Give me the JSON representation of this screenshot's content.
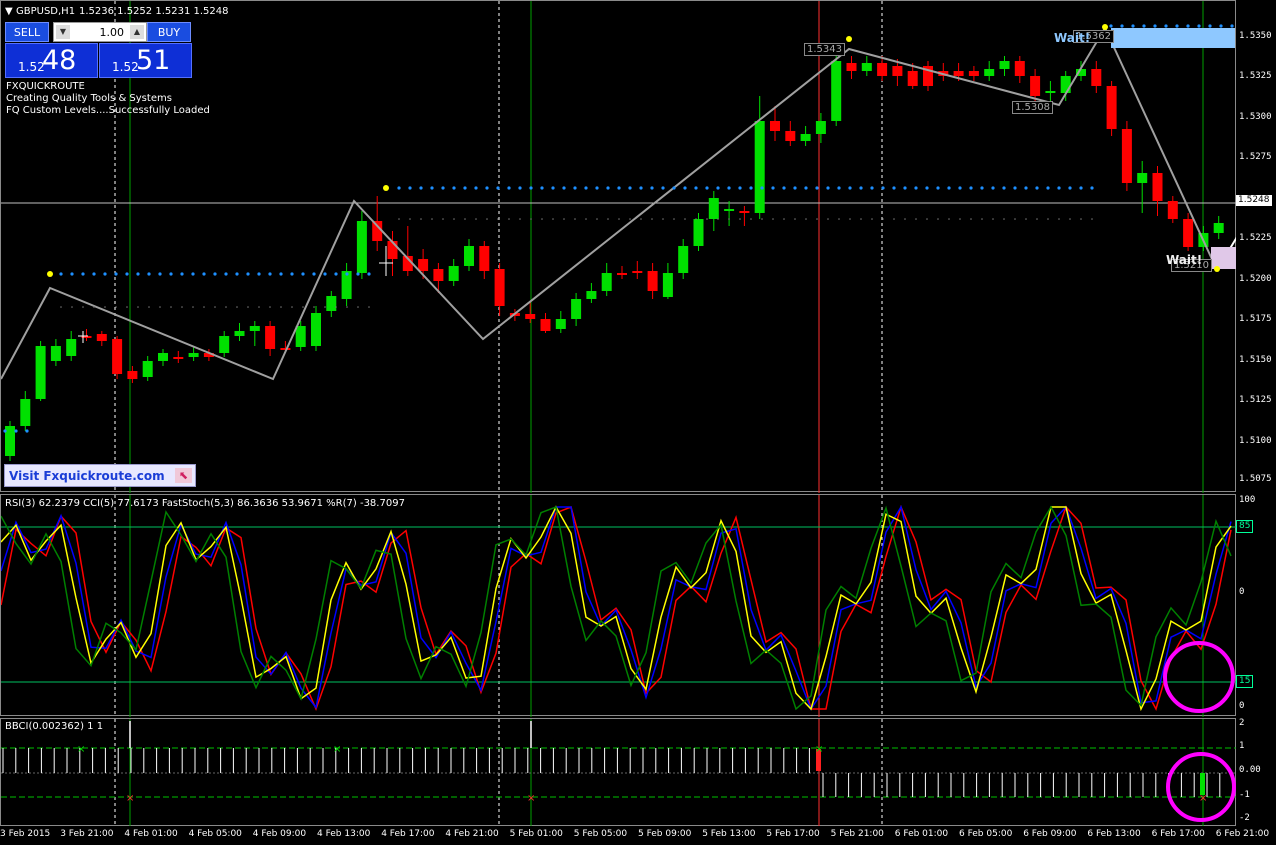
{
  "chart": {
    "symbol_timeframe": "GBPUSD,H1",
    "ohlc": "1.5236 1.5252 1.5231 1.5248",
    "current_price": "1.5248"
  },
  "trade_panel": {
    "sell_label": "SELL",
    "buy_label": "BUY",
    "lot_size": "1.00",
    "sell_price_small": "1.52",
    "sell_price_big": "48",
    "buy_price_small": "1.52",
    "buy_price_big": "51"
  },
  "indicator_info": {
    "line1": "FXQUICKROUTE",
    "line2": "Creating Quality Tools & Systems",
    "line3": "FQ Custom Levels....Successfully Loaded"
  },
  "banner": {
    "text": "Visit Fxquickroute.com"
  },
  "annotations": {
    "wait_top": "Wait!",
    "wait_bottom": "Wait!",
    "level_1": "1.5343",
    "level_2": "1.5308",
    "level_3": "1.5362",
    "level_4": "1.5210"
  },
  "price_axis": [
    "1.5350",
    "1.5325",
    "1.5300",
    "1.5275",
    "1.5225",
    "1.5200",
    "1.5175",
    "1.5150",
    "1.5125",
    "1.5100",
    "1.5075"
  ],
  "oscillator": {
    "title": "RSI(3) 62.2379  CCI(5) 77.6173  FastStoch(5,3) 86.3636 53.9671  %R(7) -38.7097",
    "axis": [
      "100",
      "85",
      "15",
      "0"
    ],
    "level_high": "85",
    "level_low": "15"
  },
  "bbci": {
    "title": "BBCI(0.002362) 1 1",
    "axis": [
      "2",
      "1",
      "0.00",
      "-1",
      "-2"
    ]
  },
  "time_axis": [
    "3 Feb 2015",
    "3 Feb 21:00",
    "4 Feb 01:00",
    "4 Feb 05:00",
    "4 Feb 09:00",
    "4 Feb 13:00",
    "4 Feb 17:00",
    "4 Feb 21:00",
    "5 Feb 01:00",
    "5 Feb 05:00",
    "5 Feb 09:00",
    "5 Feb 13:00",
    "5 Feb 17:00",
    "5 Feb 21:00",
    "6 Feb 01:00",
    "6 Feb 05:00",
    "6 Feb 09:00",
    "6 Feb 13:00",
    "6 Feb 17:00",
    "6 Feb 21:00"
  ],
  "colors": {
    "bull": "#00e000",
    "bear": "#ff0000",
    "zigzag": "#a0a0a0",
    "dots": "#1e90ff",
    "rsi": "#ff0000",
    "cci": "#0000ff",
    "stoch": "#ffff00",
    "wpr": "#008000",
    "highlight": "#ff00ff"
  }
}
